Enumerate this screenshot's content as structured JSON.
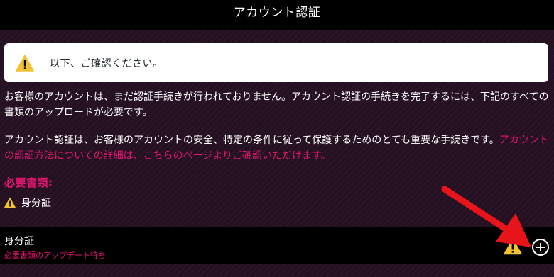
{
  "header": {
    "title": "アカウント認証"
  },
  "notice": {
    "text": "以下、ご確認ください。"
  },
  "body": {
    "paragraph1": "お客様のアカウントは、まだ認証手続きが行われておりません。アカウント認証の手続きを完了するには、下記のすべての書類のアップロードが必要です。",
    "paragraph2_prefix": "アカウント認証は、お客様のアカウントの安全、特定の条件に従って保護するためのとても重要な手続きです。",
    "paragraph2_link": "アカウントの認証方法についての詳細は、こちらのページよりご確認いただけます。"
  },
  "required_documents": {
    "heading": "必要書類:",
    "items": [
      {
        "label": "身分証",
        "icon": "warning-icon"
      }
    ]
  },
  "document_row": {
    "title": "身分証",
    "status": "必要書類のアップデート待ち",
    "status_icon": "warning-icon",
    "action_icon": "plus-circle-icon"
  },
  "colors": {
    "accent": "#e0156f",
    "warning": "#f2c230",
    "arrow": "#e8141b",
    "background": "#241021",
    "header": "#000000"
  }
}
